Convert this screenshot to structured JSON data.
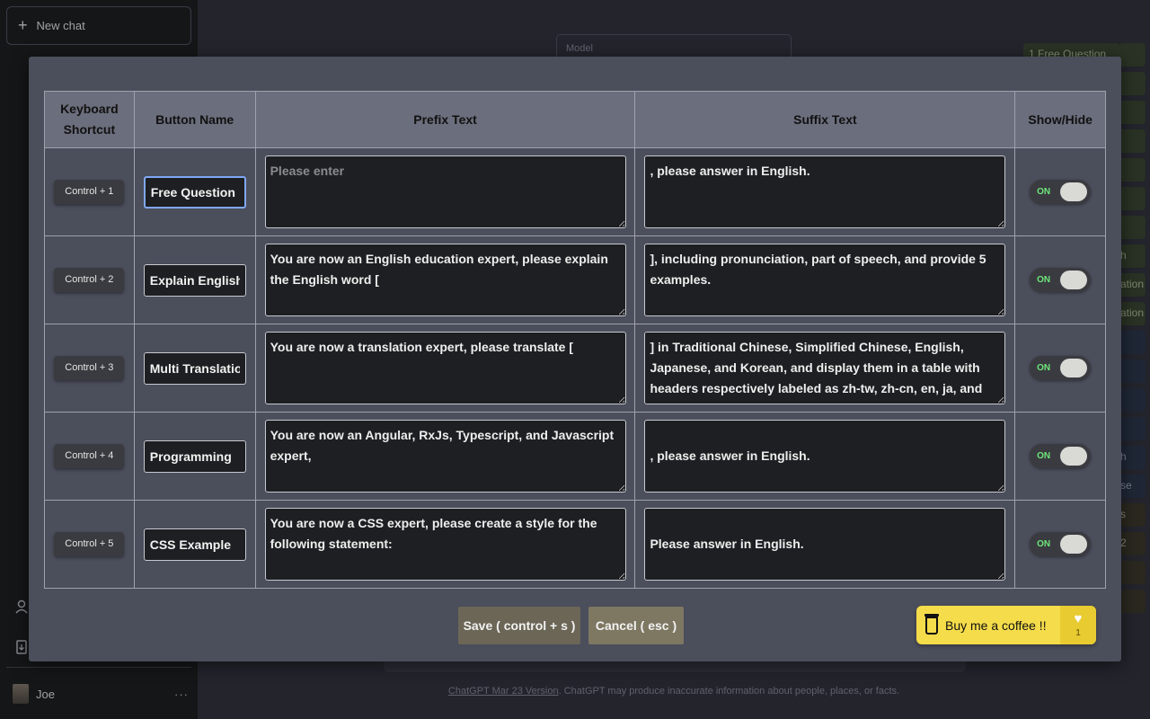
{
  "sidebar": {
    "new_chat_label": "New chat",
    "user_name": "Joe",
    "more_label": "···"
  },
  "main": {
    "model_label": "Model",
    "footer_link": "ChatGPT Mar 23 Version",
    "footer_text": ". ChatGPT may produce inaccurate information about people, places, or facts."
  },
  "background_buttons": {
    "items": [
      {
        "label": "1 Free Question",
        "ext": ""
      },
      {
        "label": "",
        "ext": ""
      },
      {
        "label": "",
        "ext": ""
      },
      {
        "label": "",
        "ext": ""
      },
      {
        "label": "",
        "ext": ""
      },
      {
        "label": "",
        "ext": ""
      },
      {
        "label": "",
        "ext": ""
      },
      {
        "label": "",
        "ext": "h"
      },
      {
        "label": "",
        "ext": "ation"
      },
      {
        "label": "",
        "ext": "ation"
      },
      {
        "label": "",
        "ext": ""
      },
      {
        "label": "",
        "ext": ""
      },
      {
        "label": "",
        "ext": ""
      },
      {
        "label": "",
        "ext": ""
      },
      {
        "label": "",
        "ext": "h"
      },
      {
        "label": "",
        "ext": "se"
      },
      {
        "label": "",
        "ext": "s"
      },
      {
        "label": "",
        "ext": "2"
      },
      {
        "label": "",
        "ext": ""
      },
      {
        "label": "",
        "ext": ""
      }
    ]
  },
  "modal": {
    "headers": {
      "shortcut": "Keyboard Shortcut",
      "name": "Button Name",
      "prefix": "Prefix Text",
      "suffix": "Suffix Text",
      "show": "Show/Hide"
    },
    "rows": [
      {
        "shortcut": "Control + 1",
        "name": "Free Question",
        "prefix": "",
        "prefix_placeholder": "Please enter",
        "suffix": ", please answer in English.",
        "toggle": "ON"
      },
      {
        "shortcut": "Control + 2",
        "name": "Explain English",
        "prefix": "You are now an English education expert, please explain the English word [",
        "prefix_placeholder": "",
        "suffix": "], including pronunciation, part of speech, and provide 5 examples.",
        "toggle": "ON"
      },
      {
        "shortcut": "Control + 3",
        "name": "Multi Translation",
        "prefix": "You are now a translation expert, please translate [",
        "prefix_placeholder": "",
        "suffix": "] in Traditional Chinese, Simplified Chinese, English, Japanese, and Korean, and display them in a table with headers respectively labeled as zh-tw, zh-cn, en, ja, and ko. No further",
        "toggle": "ON"
      },
      {
        "shortcut": "Control + 4",
        "name": "Programming",
        "prefix": "You are now an Angular, RxJs, Typescript, and Javascript expert,",
        "prefix_placeholder": "",
        "suffix": ", please answer in English.",
        "toggle": "ON"
      },
      {
        "shortcut": "Control + 5",
        "name": "CSS Example",
        "prefix": "You are now a CSS expert, please create a style for the following statement:",
        "prefix_placeholder": "",
        "suffix": "Please answer in English.",
        "toggle": "ON"
      }
    ],
    "save_label": "Save ( control + s )",
    "cancel_label": "Cancel ( esc )",
    "coffee_label": "Buy me a coffee !!",
    "coffee_count": "1"
  },
  "colors": {
    "modal_bg": "#4b4e5b",
    "header_bg": "#6b6e7c",
    "coffee_yellow": "#f5dc4a",
    "toggle_on": "#6ee77a",
    "focus_border": "#7ea7f5"
  }
}
